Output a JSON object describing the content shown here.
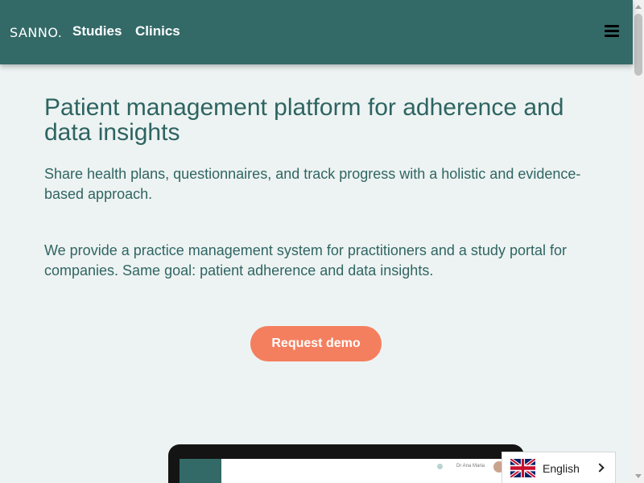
{
  "nav": {
    "logo": "SANNO.",
    "links": [
      {
        "label": "Studies"
      },
      {
        "label": "Clinics"
      }
    ]
  },
  "hero": {
    "headline": "Patient management platform for adherence and data insights",
    "paragraph1": "Share health plans, questionnaires, and track progress with a holistic and evidence-based approach.",
    "paragraph2": "We provide a practice management system for practitioners and a study portal for companies. Same goal: patient adherence and data insights.",
    "cta_label": "Request demo"
  },
  "device_preview": {
    "user_name": "Dr Ana Maria"
  },
  "language": {
    "current": "English"
  },
  "colors": {
    "primary": "#336a68",
    "accent": "#f47f5f",
    "background": "#edf3f2",
    "text": "#2f6563"
  },
  "icons": {
    "menu": "hamburger-menu-icon",
    "flag": "uk-flag-icon",
    "chevron": "chevron-right-icon"
  }
}
